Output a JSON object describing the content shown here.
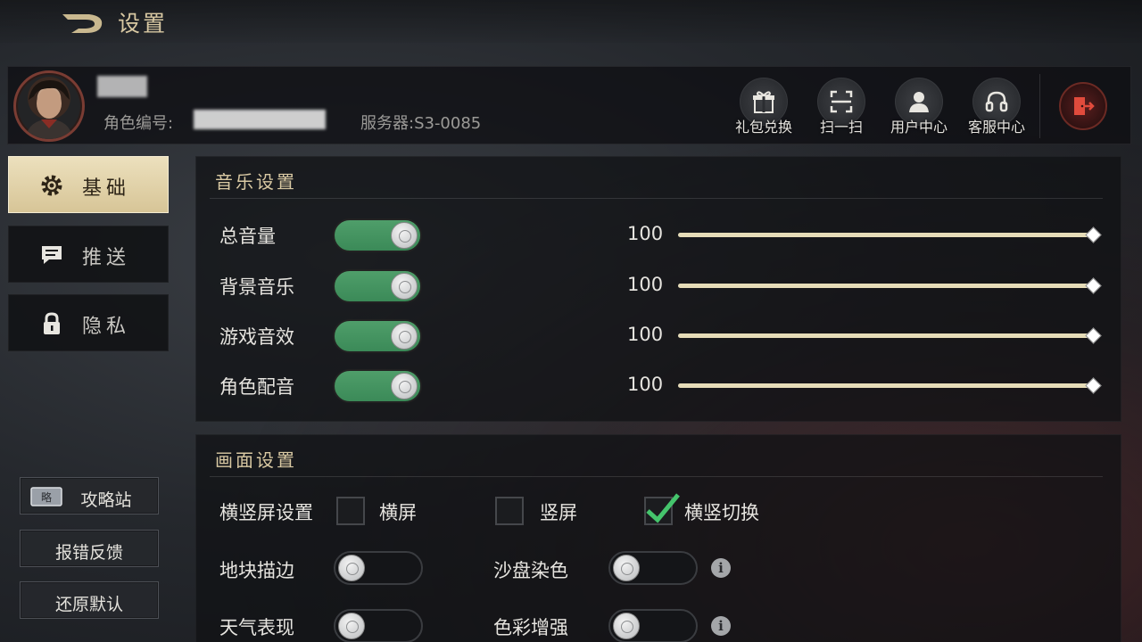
{
  "header": {
    "title": "设置"
  },
  "profile": {
    "role_id_label": "角色编号:",
    "server_label": "服务器:S3-0085"
  },
  "tools": [
    {
      "label": "礼包兑换",
      "icon": "gift-icon"
    },
    {
      "label": "扫一扫",
      "icon": "scan-icon"
    },
    {
      "label": "用户中心",
      "icon": "user-icon"
    },
    {
      "label": "客服中心",
      "icon": "headset-icon"
    }
  ],
  "nav": [
    {
      "label": "基础",
      "icon": "gear-icon",
      "active": true
    },
    {
      "label": "推送",
      "icon": "message-icon",
      "active": false
    },
    {
      "label": "隐私",
      "icon": "lock-icon",
      "active": false
    }
  ],
  "side_buttons": {
    "guide": "攻略站",
    "guide_icon_text": "略",
    "feedback": "报错反馈",
    "restore": "还原默认"
  },
  "music": {
    "title": "音乐设置",
    "rows": [
      {
        "label": "总音量",
        "on": true,
        "value": "100",
        "level": 1.0
      },
      {
        "label": "背景音乐",
        "on": true,
        "value": "100",
        "level": 1.0
      },
      {
        "label": "游戏音效",
        "on": true,
        "value": "100",
        "level": 1.0
      },
      {
        "label": "角色配音",
        "on": true,
        "value": "100",
        "level": 1.0
      }
    ]
  },
  "display": {
    "title": "画面设置",
    "orientation_label": "横竖屏设置",
    "orientation_options": [
      {
        "label": "横屏",
        "checked": false
      },
      {
        "label": "竖屏",
        "checked": false
      },
      {
        "label": "横竖切换",
        "checked": true
      }
    ],
    "edge_outline": {
      "label": "地块描边",
      "on": false
    },
    "sand_coloring": {
      "label": "沙盘染色",
      "on": false
    },
    "weather": {
      "label": "天气表现",
      "on": false
    },
    "color_enhance": {
      "label": "色彩增强",
      "on": false
    },
    "info_glyph": "i"
  },
  "colors": {
    "accent_gold": "#d9c9a3",
    "toggle_on": "#4f9e6a",
    "logout_red": "#e14b3c"
  }
}
